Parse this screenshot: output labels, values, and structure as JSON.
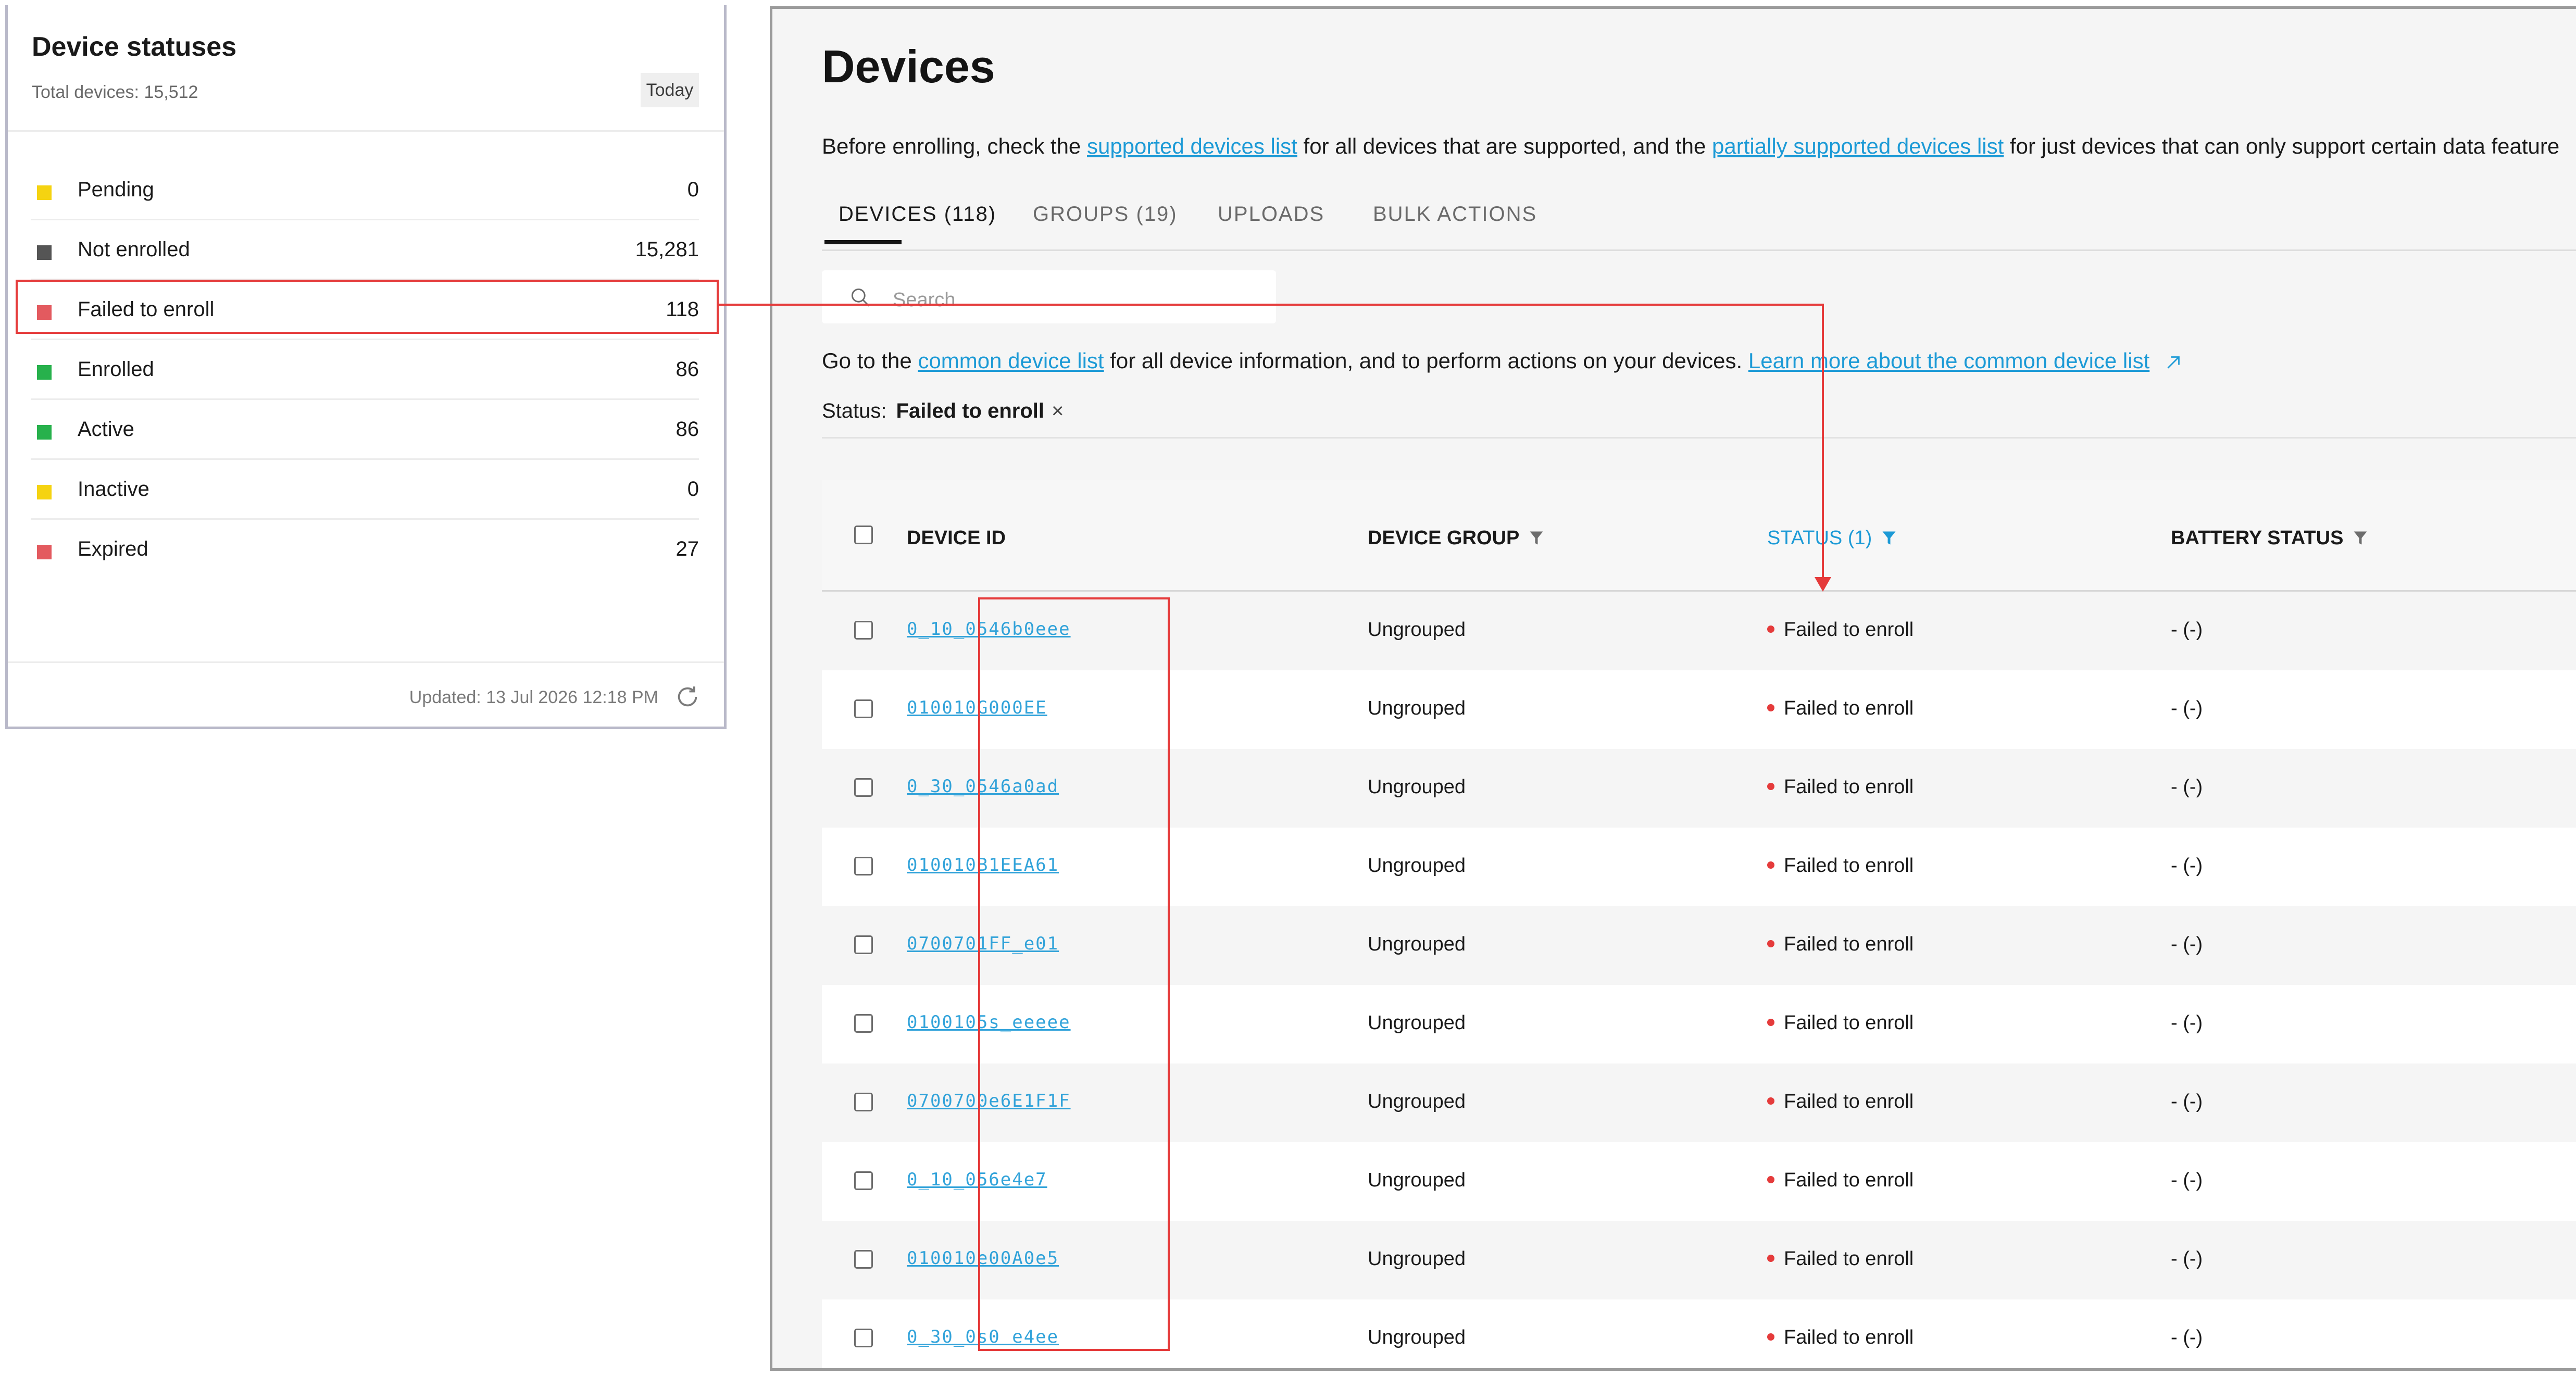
{
  "status_card": {
    "title": "Device statuses",
    "total_label": "Total devices: 15,512",
    "period": "Today",
    "items": [
      {
        "label": "Pending",
        "value": "0",
        "color": "#f5d311"
      },
      {
        "label": "Not enrolled",
        "value": "15,281",
        "color": "#555555"
      },
      {
        "label": "Failed to enroll",
        "value": "118",
        "color": "#e35a5f"
      },
      {
        "label": "Enrolled",
        "value": "86",
        "color": "#27b14c"
      },
      {
        "label": "Active",
        "value": "86",
        "color": "#27b14c"
      },
      {
        "label": "Inactive",
        "value": "0",
        "color": "#f5d311"
      },
      {
        "label": "Expired",
        "value": "27",
        "color": "#e35a5f"
      }
    ],
    "updated": "Updated: 13 Jul 2026 12:18 PM",
    "refresh_icon": "refresh-icon"
  },
  "devices_page": {
    "title": "Devices",
    "intro": {
      "prefix": "Before enrolling, check the ",
      "link1": "supported devices list",
      "middle": " for all devices that are supported, and the ",
      "link2": "partially supported devices list",
      "suffix": " for just devices that can only support certain data feature"
    },
    "tabs": [
      {
        "label": "DEVICES (118)",
        "active": true
      },
      {
        "label": "GROUPS (19)",
        "active": false
      },
      {
        "label": "UPLOADS",
        "active": false
      },
      {
        "label": "BULK ACTIONS",
        "active": false
      }
    ],
    "search": {
      "placeholder": "Search",
      "icon": "search-icon"
    },
    "info": {
      "prefix": "Go to the ",
      "link1": "common device list",
      "middle": " for all device information, and to perform actions on your devices. ",
      "link2": "Learn more about the common device list",
      "icon": "external-link-icon"
    },
    "filter": {
      "label": "Status:",
      "value": "Failed to enroll"
    },
    "table": {
      "columns": [
        "DEVICE ID",
        "DEVICE GROUP",
        "STATUS (1)",
        "BATTERY STATUS"
      ],
      "rows": [
        {
          "id": "0_10_0546b0eee",
          "group": "Ungrouped",
          "status": "Failed to enroll",
          "battery": "- (-)"
        },
        {
          "id": "010010G000EE",
          "group": "Ungrouped",
          "status": "Failed to enroll",
          "battery": "- (-)"
        },
        {
          "id": "0_30_0546a0ad",
          "group": "Ungrouped",
          "status": "Failed to enroll",
          "battery": "- (-)"
        },
        {
          "id": "010010B1EEA61",
          "group": "Ungrouped",
          "status": "Failed to enroll",
          "battery": "- (-)"
        },
        {
          "id": "0700701FF_e01",
          "group": "Ungrouped",
          "status": "Failed to enroll",
          "battery": "- (-)"
        },
        {
          "id": "0100105s_eeeee",
          "group": "Ungrouped",
          "status": "Failed to enroll",
          "battery": "- (-)"
        },
        {
          "id": "0700700e6E1F1F",
          "group": "Ungrouped",
          "status": "Failed to enroll",
          "battery": "- (-)"
        },
        {
          "id": "0_10_056e4e7",
          "group": "Ungrouped",
          "status": "Failed to enroll",
          "battery": "- (-)"
        },
        {
          "id": "010010e00A0e5",
          "group": "Ungrouped",
          "status": "Failed to enroll",
          "battery": "- (-)"
        },
        {
          "id": "0_30_0s0 e4ee",
          "group": "Ungrouped",
          "status": "Failed to enroll",
          "battery": "- (-)"
        }
      ]
    }
  },
  "colors": {
    "accent": "#1c9ad6",
    "highlight": "#e53b3b"
  }
}
